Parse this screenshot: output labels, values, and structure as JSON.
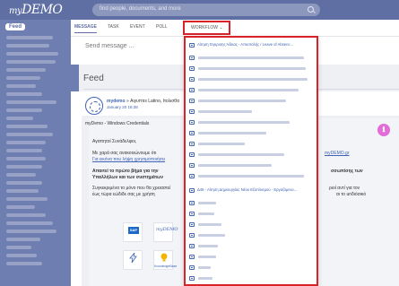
{
  "app": {
    "logo_prefix": "my",
    "logo_text": "DEMO"
  },
  "search": {
    "placeholder": "find people, documents, and more"
  },
  "sidebar": {
    "active_item": "Feed"
  },
  "composer": {
    "tabs": [
      {
        "label": "MESSAGE"
      },
      {
        "label": "TASK"
      },
      {
        "label": "EVENT"
      },
      {
        "label": "POLL"
      },
      {
        "label": "WORKFLOW ⌄"
      }
    ],
    "message_placeholder": "Send message ..."
  },
  "feed": {
    "title": "Feed",
    "post": {
      "author": "mydemo",
      "recipients": "» Αιγυπτιs Latino, Ιτολισθα",
      "date": "January 20 16:38",
      "subject": "myDemo - Windows Credentials",
      "greeting": "Αγαπητοί Συνάδελφοι,",
      "body_line1": "Με χαρά σας ανακοινώνουμε ότι",
      "body_link1": "myDEMO.gr",
      "body_link2": "Για εικόνα που λήψη χρησιμοποιήσει",
      "bold_line1": "Απαιτεί το πρώτο βήμα για την",
      "bold_line1_end": "σσωπίσης των",
      "bold_line2": "Υπαλλήλων και των συστημάτων",
      "body_line3": "Συγκεκριμένα το μόνο που θα χρειαστεί",
      "body_line3_end": "ριοί αντί για τον",
      "body_line4": "έως τώρα εώδιδε σας με χρήση",
      "body_line4_end": "αι το unδιόσικό",
      "info_icon": "ℹ",
      "tiles": [
        {
          "label": "SAP"
        },
        {
          "label": "myDEMO"
        },
        {
          "label": ""
        },
        {
          "label": "KnowledgeBase"
        }
      ]
    }
  },
  "workflow_menu": {
    "first_item": "Αίτηση Έγκρισης Άδειας - Αποστολής / Leave of Absenc...",
    "highlighted_item": "Δ46 - Αίτηση Δημιουργίας Νέου Εξοπλισμού - Εργαζόμενο...",
    "item_count": 24
  }
}
